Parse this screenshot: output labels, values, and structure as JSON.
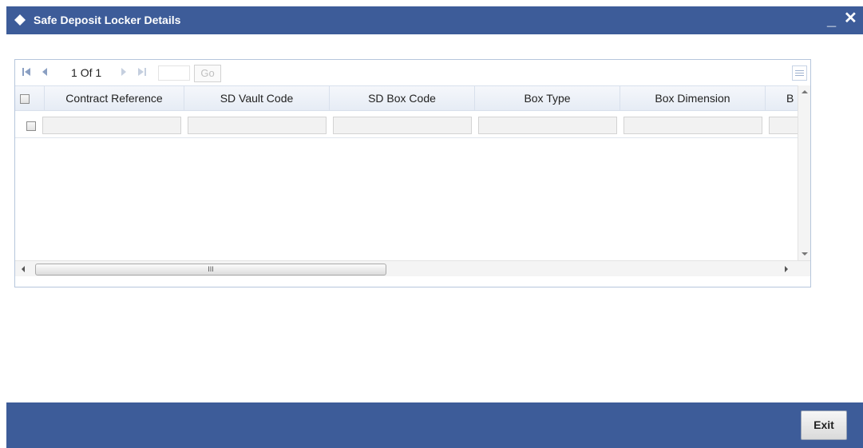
{
  "window": {
    "title": "Safe Deposit Locker Details",
    "minimize_glyph": "_",
    "close_glyph": "✕"
  },
  "pagination": {
    "current_page": "1",
    "of_label": "Of",
    "total_pages": "1",
    "page_input_value": "",
    "go_label": "Go"
  },
  "table": {
    "columns": [
      "Contract Reference",
      "SD Vault Code",
      "SD Box Code",
      "Box Type",
      "Box Dimension",
      "B"
    ],
    "rows": [
      {
        "values": [
          "",
          "",
          "",
          "",
          "",
          ""
        ],
        "checked": false
      }
    ]
  },
  "scrollbar": {
    "thumb_grip": "III"
  },
  "footer": {
    "exit_label": "Exit"
  },
  "icons": {
    "title": "diamond-icon",
    "first_page": "first-page-icon",
    "prev_page": "prev-page-icon",
    "next_page": "next-page-icon",
    "last_page": "last-page-icon",
    "settings": "grid-settings-icon"
  },
  "colors": {
    "header_bar": "#3d5c99",
    "footer_bar": "#3d5c99",
    "grid_border": "#b6c6dc",
    "header_row": "#e6ecf5"
  }
}
